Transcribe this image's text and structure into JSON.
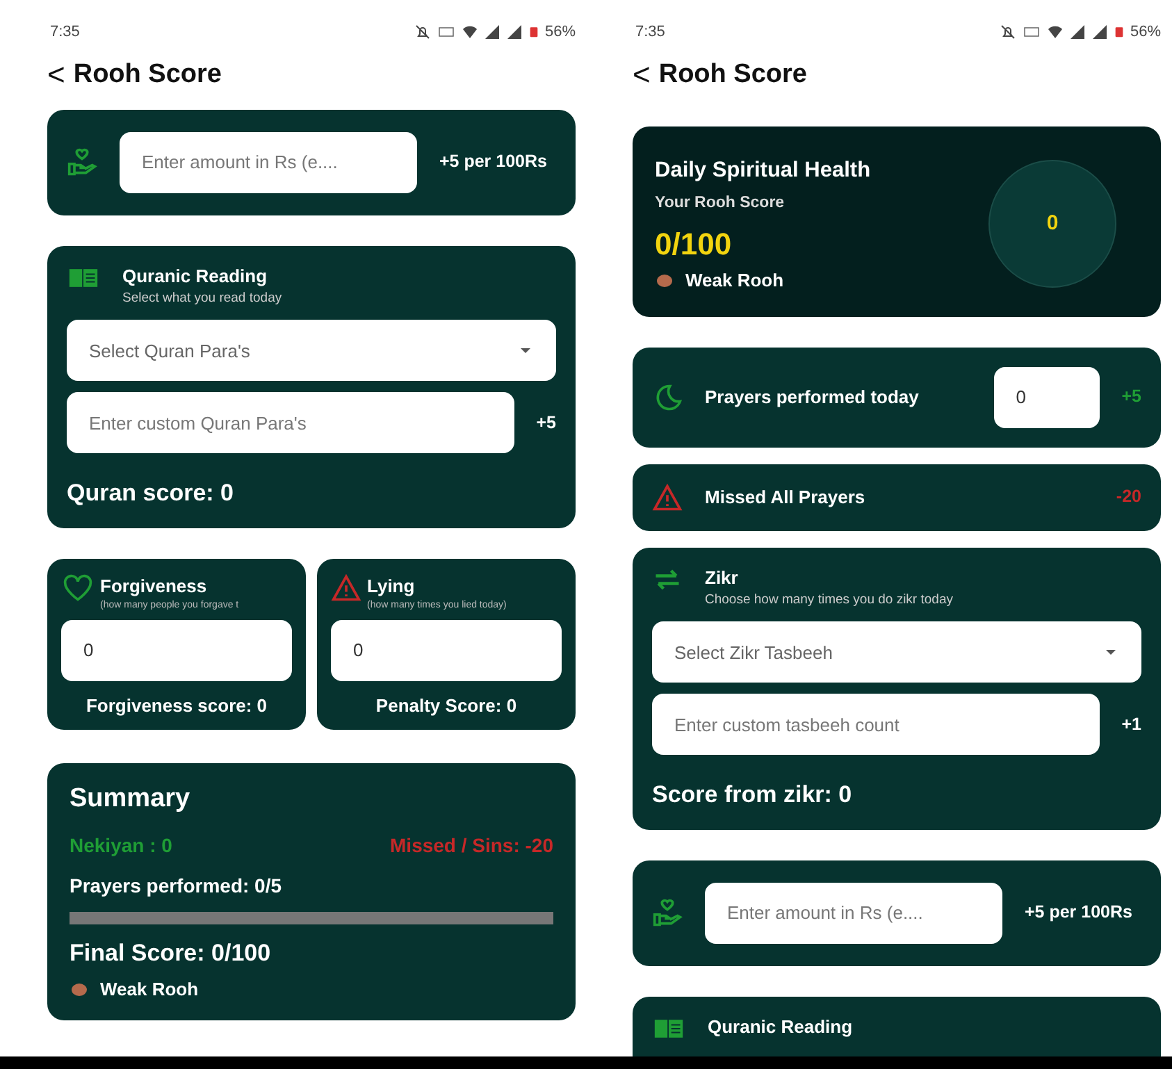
{
  "screens": [
    {
      "status_bar": {
        "time": "7:35",
        "battery": "56%"
      },
      "header": {
        "back": "<",
        "title": "Rooh Score"
      },
      "sections": [
        {
          "kind": "donation",
          "placeholder": "Enter amount in Rs (e....",
          "note": "+5 per 100Rs"
        },
        {
          "kind": "quran",
          "title": "Quranic Reading",
          "subtitle": "Select what you read today",
          "select_placeholder": "Select Quran Para's",
          "input_placeholder": "Enter custom Quran Para's",
          "bonus": "+5",
          "score": "Quran score: 0"
        },
        {
          "kind": "pair",
          "cards": [
            {
              "kind": "virtue",
              "title": "Forgiveness",
              "hint": "(how many people you forgave t",
              "value": "0",
              "score": "Forgiveness score: 0"
            },
            {
              "kind": "sin",
              "title": "Lying",
              "hint": "(how many times you lied today)",
              "value": "0",
              "score": "Penalty Score: 0"
            }
          ]
        },
        {
          "kind": "summary",
          "title": "Summary",
          "gains": "Nekiyan : 0",
          "losses": "Missed / Sins: -20",
          "prayers": "Prayers performed: 0/5",
          "level": 0,
          "final": "Final Score: 0/100",
          "status": "Weak Rooh"
        }
      ]
    },
    {
      "status_bar": {
        "time": "7:35",
        "battery": "56%"
      },
      "header": {
        "back": "<",
        "title": "Rooh Score"
      },
      "sections": [
        {
          "kind": "health",
          "title": "Daily Spiritual Health",
          "label": "Your Rooh Score",
          "score": "0/100",
          "status": "Weak Rooh",
          "gauge": {
            "value": "0"
          }
        },
        {
          "kind": "prayers",
          "text": "Prayers performed today",
          "value": "0",
          "note": "+5"
        },
        {
          "kind": "missed",
          "text": "Missed All Prayers",
          "note": "-20"
        },
        {
          "kind": "zikr",
          "title": "Zikr",
          "subtitle": "Choose how many times you do zikr today",
          "select_placeholder": "Select Zikr Tasbeeh",
          "input_placeholder": "Enter custom tasbeeh count",
          "bonus": "+1",
          "score": "Score from zikr: 0"
        },
        {
          "kind": "donation",
          "placeholder": "Enter amount in Rs (e....",
          "note": "+5 per 100Rs"
        },
        {
          "kind": "quran",
          "title": "Quranic Reading"
        }
      ]
    }
  ]
}
